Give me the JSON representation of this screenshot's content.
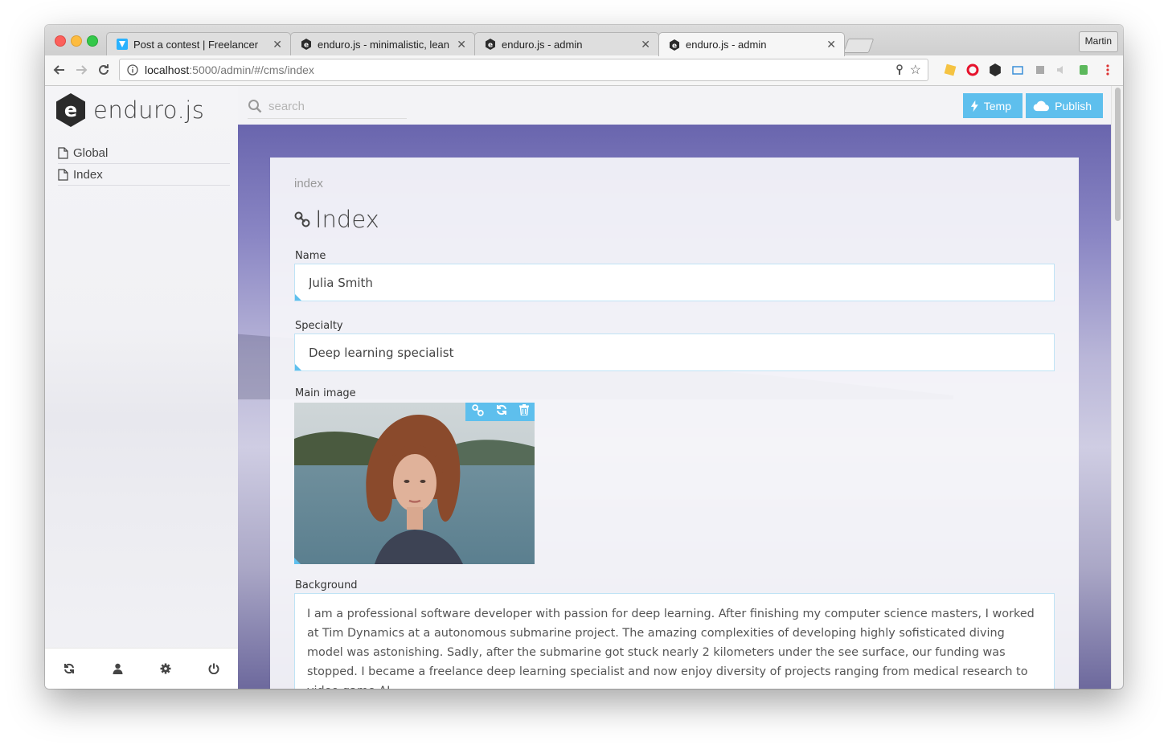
{
  "browser": {
    "tabs": [
      {
        "title": "Post a contest | Freelancer",
        "favicon": "freelancer-icon",
        "active": false
      },
      {
        "title": "enduro.js - minimalistic, lean &",
        "favicon": "enduro-icon",
        "active": false
      },
      {
        "title": "enduro.js - admin",
        "favicon": "enduro-icon",
        "active": false
      },
      {
        "title": "enduro.js - admin",
        "favicon": "enduro-icon",
        "active": true
      }
    ],
    "profile": "Martin",
    "url_host": "localhost",
    "url_path": ":5000/admin/#/cms/index"
  },
  "sidebar": {
    "logo_letter": "e",
    "logo_text": "enduro.js",
    "items": [
      {
        "label": "Global"
      },
      {
        "label": "Index"
      }
    ]
  },
  "topbar": {
    "search_placeholder": "search",
    "temp_label": "Temp",
    "publish_label": "Publish"
  },
  "content": {
    "breadcrumb": "index",
    "title": "Index",
    "name_label": "Name",
    "name_value": "Julia Smith",
    "specialty_label": "Specialty",
    "specialty_value": "Deep learning specialist",
    "image_label": "Main image",
    "background_label": "Background",
    "background_value": "I am a professional software developer with passion for deep learning. After finishing my computer science masters, I worked at Tim Dynamics at a autonomous submarine project. The amazing complexities of developing highly sofisticated diving model was astonishing. Sadly, after the submarine got stuck nearly 2 kilometers under the see surface, our funding was stopped. I became a freelance deep learning specialist and now enjoy diversity of projects ranging from medical research to video game AI."
  },
  "colors": {
    "accent": "#5ebfed",
    "field_border": "#bfe3f5",
    "logo_hex": "#2b2b2b"
  }
}
